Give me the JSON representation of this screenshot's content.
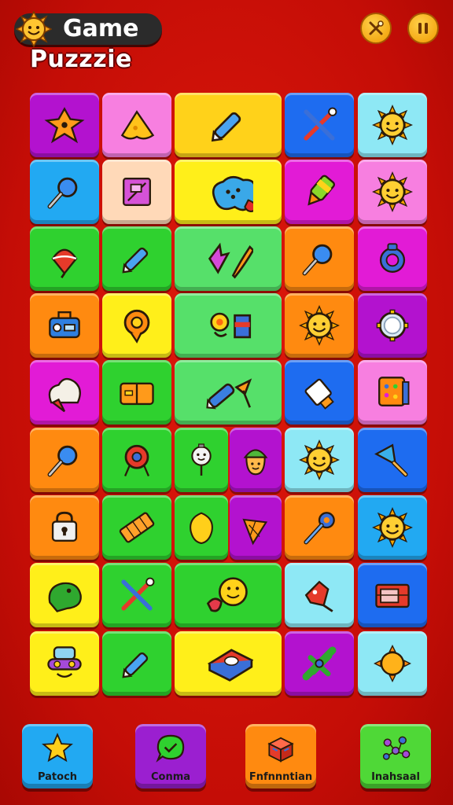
{
  "header": {
    "title_line1": "Game",
    "title_line2": "Puzzzie",
    "logo_icon": "sun-face-icon",
    "buttons": [
      {
        "name": "hint-button",
        "icon": "crossed-tools-icon"
      },
      {
        "name": "pause-button",
        "icon": "pause-icon"
      }
    ]
  },
  "colors": {
    "background": "#d01208",
    "purple": "#b312cf",
    "pink": "#f77fe0",
    "yellow": "#ffd21a",
    "blue": "#1e6cf0",
    "cyan": "#8ee8f5",
    "sky": "#22a9f2",
    "peach": "#ffd9b8",
    "green": "#2fd12f",
    "orange": "#ff8a10",
    "magenta": "#e21bd6",
    "lightgreen": "#56e06a",
    "lime": "#ffef1a"
  },
  "board": {
    "rows": 9,
    "columns": 5,
    "tiles": [
      {
        "icon": "star-creature-icon",
        "color": "purple"
      },
      {
        "icon": "cheese-icon",
        "color": "pink"
      },
      {
        "icon": "crayon-icon",
        "color": "yellow"
      },
      {
        "icon": "crossed-tools-icon",
        "color": "blue"
      },
      {
        "icon": "sun-face-icon",
        "color": "cyan"
      },
      {
        "icon": "magnifier-icon",
        "color": "sky"
      },
      {
        "icon": "picture-frame-icon",
        "color": "peach"
      },
      {
        "icon": "blue-blob-icon",
        "color": "lime"
      },
      {
        "icon": "marker-icon",
        "color": "magenta"
      },
      {
        "icon": "sun-face-icon",
        "color": "pink"
      },
      {
        "icon": "spinning-top-icon",
        "color": "green"
      },
      {
        "icon": "crayon-icon",
        "color": "green"
      },
      {
        "icon": "leaf-and-carrot-icon",
        "color": "lightgreen"
      },
      {
        "icon": "magnifier-icon",
        "color": "orange"
      },
      {
        "icon": "ring-icon",
        "color": "magenta"
      },
      {
        "icon": "radio-icon",
        "color": "orange"
      },
      {
        "icon": "location-pin-icon",
        "color": "lime"
      },
      {
        "icon": "flower-and-cube-icon",
        "color": "lightgreen"
      },
      {
        "icon": "sun-face-icon",
        "color": "orange"
      },
      {
        "icon": "mirror-icon",
        "color": "purple"
      },
      {
        "icon": "ice-cream-icon",
        "color": "magenta"
      },
      {
        "icon": "wallet-icon",
        "color": "green"
      },
      {
        "icon": "crayon-and-lollipop-icon",
        "color": "lightgreen"
      },
      {
        "icon": "eraser-icon",
        "color": "blue"
      },
      {
        "icon": "game-box-icon",
        "color": "pink"
      },
      {
        "icon": "magnifier-icon",
        "color": "orange"
      },
      {
        "icon": "balloon-icon",
        "color": "green"
      },
      {
        "icon": "lollipop-face-icon",
        "color": "green"
      },
      {
        "icon": "acorn-face-icon",
        "color": "purple"
      },
      {
        "icon": "sun-face-icon",
        "color": "cyan"
      },
      {
        "icon": "shovel-icon",
        "color": "blue"
      },
      {
        "icon": "lock-icon",
        "color": "orange"
      },
      {
        "icon": "chocolate-bar-icon",
        "color": "green"
      },
      {
        "icon": "lemon-icon",
        "color": "green"
      },
      {
        "icon": "cone-icon",
        "color": "purple"
      },
      {
        "icon": "wrench-icon",
        "color": "orange"
      },
      {
        "icon": "sun-face-icon",
        "color": "sky"
      },
      {
        "icon": "frog-icon",
        "color": "lime"
      },
      {
        "icon": "crossed-tools-icon",
        "color": "green"
      },
      {
        "icon": "smiley-ball-icon",
        "color": "green"
      },
      {
        "icon": "toy-car-icon",
        "color": "cyan"
      },
      {
        "icon": "toolbox-icon",
        "color": "blue"
      },
      {
        "icon": "mask-icon",
        "color": "lime"
      },
      {
        "icon": "crayon-icon",
        "color": "green"
      },
      {
        "icon": "book-icon",
        "color": "lime"
      },
      {
        "icon": "airplane-icon",
        "color": "purple"
      },
      {
        "icon": "sun-icon",
        "color": "cyan"
      }
    ]
  },
  "bottom_bar": [
    {
      "label": "Patoch",
      "icon": "star-icon",
      "color": "#22a9f2"
    },
    {
      "label": "Conma",
      "icon": "chat-check-icon",
      "color": "#9b1fd0"
    },
    {
      "label": "Fnfnnntian",
      "icon": "box-icon",
      "color": "#ff8a10"
    },
    {
      "label": "Inahsaal",
      "icon": "network-icon",
      "color": "#4fd837"
    }
  ]
}
